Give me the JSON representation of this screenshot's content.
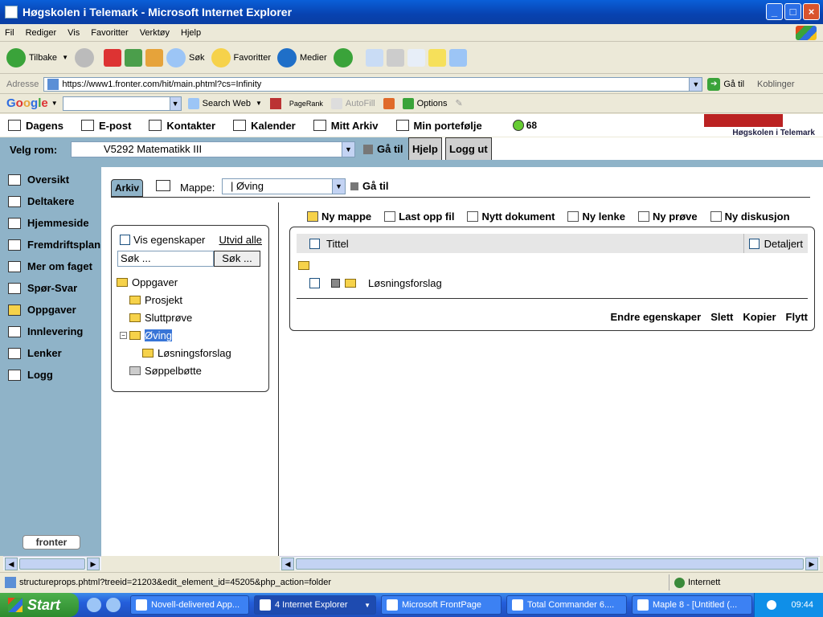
{
  "window": {
    "title": "Høgskolen i Telemark - Microsoft Internet Explorer"
  },
  "menubar": [
    "Fil",
    "Rediger",
    "Vis",
    "Favoritter",
    "Verktøy",
    "Hjelp"
  ],
  "toolbar": {
    "back": "Tilbake",
    "search": "Søk",
    "favorites": "Favoritter",
    "media": "Medier"
  },
  "addressbar": {
    "label": "Adresse",
    "url": "https://www1.fronter.com/hit/main.phtml?cs=Infinity",
    "goto": "Gå til",
    "links": "Koblinger"
  },
  "googlebar": {
    "logo": "Google",
    "search_web": "Search Web",
    "pagerank": "PageRank",
    "autofill": "AutoFill",
    "options": "Options"
  },
  "topnav": {
    "items": [
      "Dagens",
      "E-post",
      "Kontakter",
      "Kalender",
      "Mitt Arkiv",
      "Min portefølje"
    ],
    "count": "68",
    "logo_text": "Høgskolen i Telemark"
  },
  "room": {
    "label": "Velg rom:",
    "selected": "V5292 Matematikk III",
    "goto": "Gå til",
    "help": "Hjelp",
    "logout": "Logg ut"
  },
  "sidebar": {
    "items": [
      "Oversikt",
      "Deltakere",
      "Hjemmeside",
      "Fremdriftsplan",
      "Mer om faget",
      "Spør-Svar",
      "Oppgaver",
      "Innlevering",
      "Lenker",
      "Logg"
    ],
    "logo": "fronter"
  },
  "archive": {
    "tab": "Arkiv",
    "folder_label": "Mappe:",
    "folder_selected": "|  Øving",
    "goto": "Gå til"
  },
  "tree": {
    "show_props": "Vis egenskaper",
    "expand_all": "Utvid alle",
    "search_placeholder": "Søk ...",
    "search_button": "Søk ...",
    "nodes": {
      "root": "Oppgaver",
      "n1": "Prosjekt",
      "n2": "Sluttprøve",
      "n3": "Øving",
      "n3a": "Løsningsforslag",
      "trash": "Søppelbøtte"
    }
  },
  "actions": [
    "Ny mappe",
    "Last opp fil",
    "Nytt dokument",
    "Ny lenke",
    "Ny prøve",
    "Ny diskusjon"
  ],
  "list": {
    "col_title": "Tittel",
    "col_detail": "Detaljert",
    "rows": [
      "Løsningsforslag"
    ],
    "bottom_actions": [
      "Endre egenskaper",
      "Slett",
      "Kopier",
      "Flytt"
    ]
  },
  "statusbar": {
    "text": "structureprops.phtml?treeid=21203&edit_element_id=45205&php_action=folder",
    "zone": "Internett"
  },
  "taskbar": {
    "start": "Start",
    "tasks": [
      "Novell-delivered App...",
      "4 Internet Explorer",
      "Microsoft FrontPage",
      "Total Commander 6....",
      "Maple 8 - [Untitled (..."
    ],
    "clock": "09:44"
  }
}
